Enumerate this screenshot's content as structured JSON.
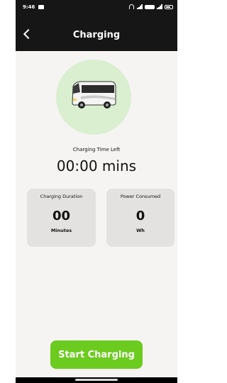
{
  "status_bar": {
    "time": "9:46"
  },
  "app_bar": {
    "title": "Charging"
  },
  "charging": {
    "time_left_label": "Charging Time Left",
    "time_left_value": "00:00 mins"
  },
  "cards": {
    "duration": {
      "title": "Charging Duration",
      "value": "00",
      "unit": "Minutes"
    },
    "power": {
      "title": "Power Consumed",
      "value": "0",
      "unit": "Wh"
    }
  },
  "actions": {
    "start_label": "Start Charging"
  },
  "colors": {
    "accent": "#6ccb1f",
    "header": "#161616",
    "circle": "#d9efcf",
    "card": "#e3e2e1"
  },
  "icons": [
    "message-icon",
    "wifi-icon",
    "signal-icon",
    "battery-icon",
    "back-icon",
    "bus-icon"
  ]
}
